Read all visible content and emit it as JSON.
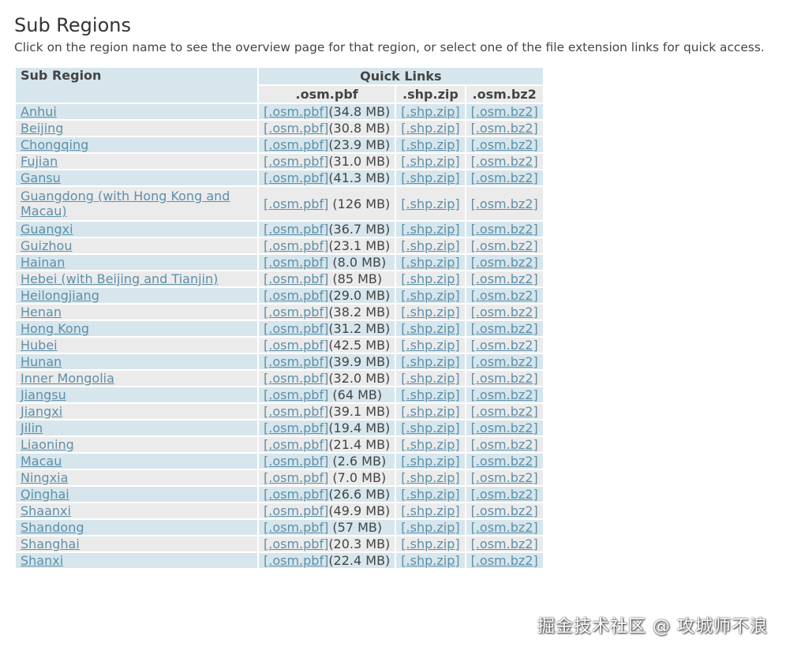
{
  "page": {
    "title": "Sub Regions",
    "subtitle": "Click on the region name to see the overview page for that region, or select one of the file extension links for quick access."
  },
  "table": {
    "header_sub_region": "Sub Region",
    "header_quick_links": "Quick Links",
    "col_pbf": ".osm.pbf",
    "col_shp": ".shp.zip",
    "col_bz2": ".osm.bz2",
    "link_pbf": "[.osm.pbf]",
    "link_shp": "[.shp.zip]",
    "link_bz2": "[.osm.bz2]",
    "rows": [
      {
        "name": "Anhui",
        "size": "(34.8 MB)"
      },
      {
        "name": "Beijing",
        "size": "(30.8 MB)"
      },
      {
        "name": "Chongqing",
        "size": "(23.9 MB)"
      },
      {
        "name": "Fujian",
        "size": "(31.0 MB)"
      },
      {
        "name": "Gansu",
        "size": "(41.3 MB)"
      },
      {
        "name": "Guangdong (with Hong Kong and Macau)",
        "size": " (126 MB)"
      },
      {
        "name": "Guangxi",
        "size": "(36.7 MB)"
      },
      {
        "name": "Guizhou",
        "size": "(23.1 MB)"
      },
      {
        "name": "Hainan",
        "size": " (8.0 MB)"
      },
      {
        "name": "Hebei (with Beijing and Tianjin)",
        "size": " (85 MB)"
      },
      {
        "name": "Heilongjiang",
        "size": "(29.0 MB)"
      },
      {
        "name": "Henan",
        "size": "(38.2 MB)"
      },
      {
        "name": "Hong Kong",
        "size": "(31.2 MB)"
      },
      {
        "name": "Hubei",
        "size": "(42.5 MB)"
      },
      {
        "name": "Hunan",
        "size": "(39.9 MB)"
      },
      {
        "name": "Inner Mongolia",
        "size": "(32.0 MB)"
      },
      {
        "name": "Jiangsu",
        "size": " (64 MB)"
      },
      {
        "name": "Jiangxi",
        "size": "(39.1 MB)"
      },
      {
        "name": "Jilin",
        "size": "(19.4 MB)"
      },
      {
        "name": "Liaoning",
        "size": "(21.4 MB)"
      },
      {
        "name": "Macau",
        "size": " (2.6 MB)"
      },
      {
        "name": "Ningxia",
        "size": " (7.0 MB)"
      },
      {
        "name": "Qinghai",
        "size": "(26.6 MB)"
      },
      {
        "name": "Shaanxi",
        "size": "(49.9 MB)"
      },
      {
        "name": "Shandong",
        "size": " (57 MB)"
      },
      {
        "name": "Shanghai",
        "size": "(20.3 MB)"
      },
      {
        "name": "Shanxi",
        "size": "(22.4 MB)"
      }
    ]
  },
  "watermark": "掘金技术社区 @ 攻城师不浪",
  "colors": {
    "link": "#5e8fa9",
    "row_blue": "#d6e6ec",
    "row_gray": "#ebebeb",
    "text": "#333333"
  }
}
